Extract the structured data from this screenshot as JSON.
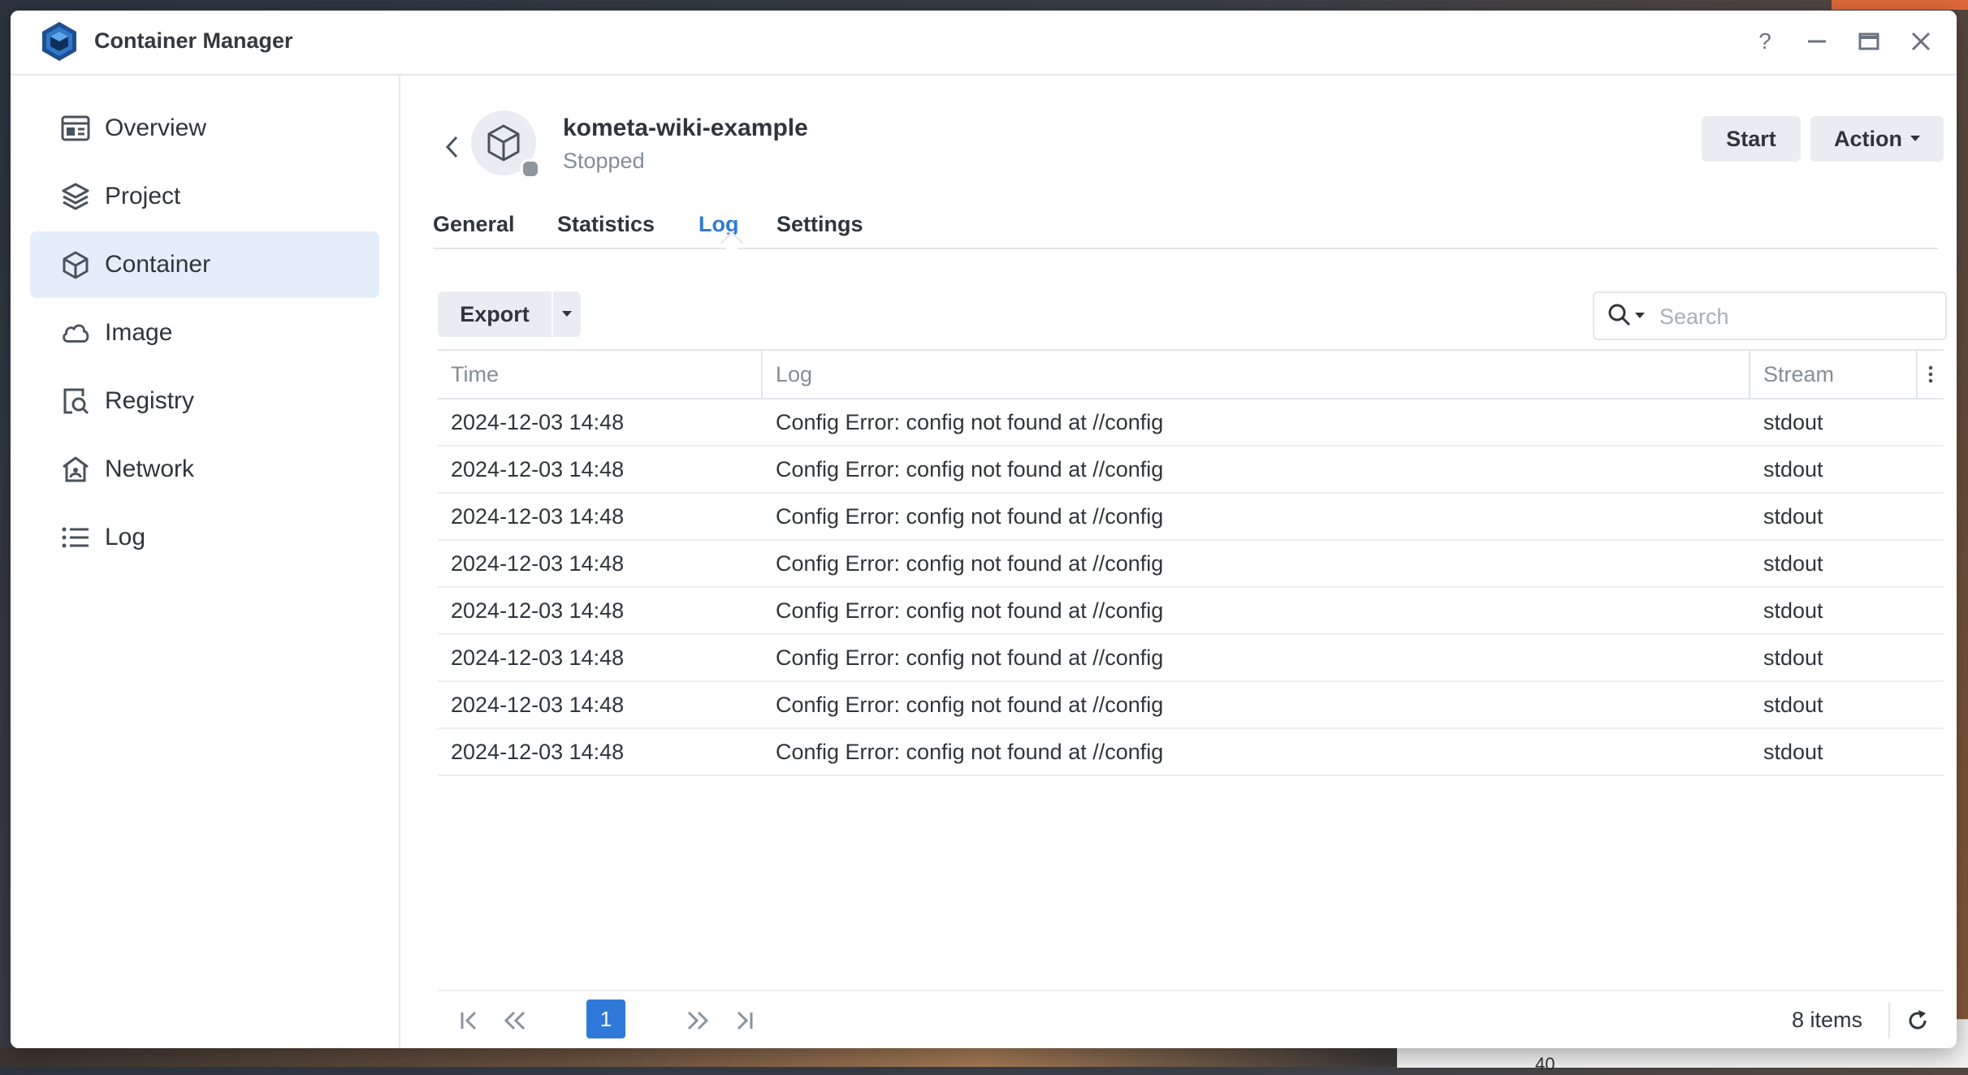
{
  "app": {
    "title": "Container Manager"
  },
  "window_controls": {
    "help": "?",
    "minimize": "–",
    "maximize": "▭",
    "close": "✕"
  },
  "sidebar": {
    "items": [
      {
        "label": "Overview",
        "icon": "overview-icon",
        "active": false
      },
      {
        "label": "Project",
        "icon": "layers-icon",
        "active": false
      },
      {
        "label": "Container",
        "icon": "cube-icon",
        "active": true
      },
      {
        "label": "Image",
        "icon": "cloud-icon",
        "active": false
      },
      {
        "label": "Registry",
        "icon": "registry-search-icon",
        "active": false
      },
      {
        "label": "Network",
        "icon": "network-house-icon",
        "active": false
      },
      {
        "label": "Log",
        "icon": "list-icon",
        "active": false
      }
    ]
  },
  "container": {
    "name": "kometa-wiki-example",
    "status": "Stopped"
  },
  "actions": {
    "start_label": "Start",
    "action_label": "Action"
  },
  "tabs": [
    {
      "label": "General",
      "active": false
    },
    {
      "label": "Statistics",
      "active": false
    },
    {
      "label": "Log",
      "active": true
    },
    {
      "label": "Settings",
      "active": false
    }
  ],
  "toolbar": {
    "export_label": "Export",
    "search_placeholder": "Search"
  },
  "table": {
    "columns": [
      "Time",
      "Log",
      "Stream"
    ],
    "rows": [
      [
        "2024-12-03 14:48",
        "Config Error: config not found at //config",
        "stdout"
      ],
      [
        "2024-12-03 14:48",
        "Config Error: config not found at //config",
        "stdout"
      ],
      [
        "2024-12-03 14:48",
        "Config Error: config not found at //config",
        "stdout"
      ],
      [
        "2024-12-03 14:48",
        "Config Error: config not found at //config",
        "stdout"
      ],
      [
        "2024-12-03 14:48",
        "Config Error: config not found at //config",
        "stdout"
      ],
      [
        "2024-12-03 14:48",
        "Config Error: config not found at //config",
        "stdout"
      ],
      [
        "2024-12-03 14:48",
        "Config Error: config not found at //config",
        "stdout"
      ],
      [
        "2024-12-03 14:48",
        "Config Error: config not found at //config",
        "stdout"
      ]
    ]
  },
  "pagination": {
    "current_page": "1",
    "item_count": "8 items"
  },
  "background": {
    "visible_number": "40"
  },
  "colors": {
    "accent": "#2f7ad8",
    "active_nav_bg": "#e3eefa",
    "button_bg": "#e9edf2"
  }
}
